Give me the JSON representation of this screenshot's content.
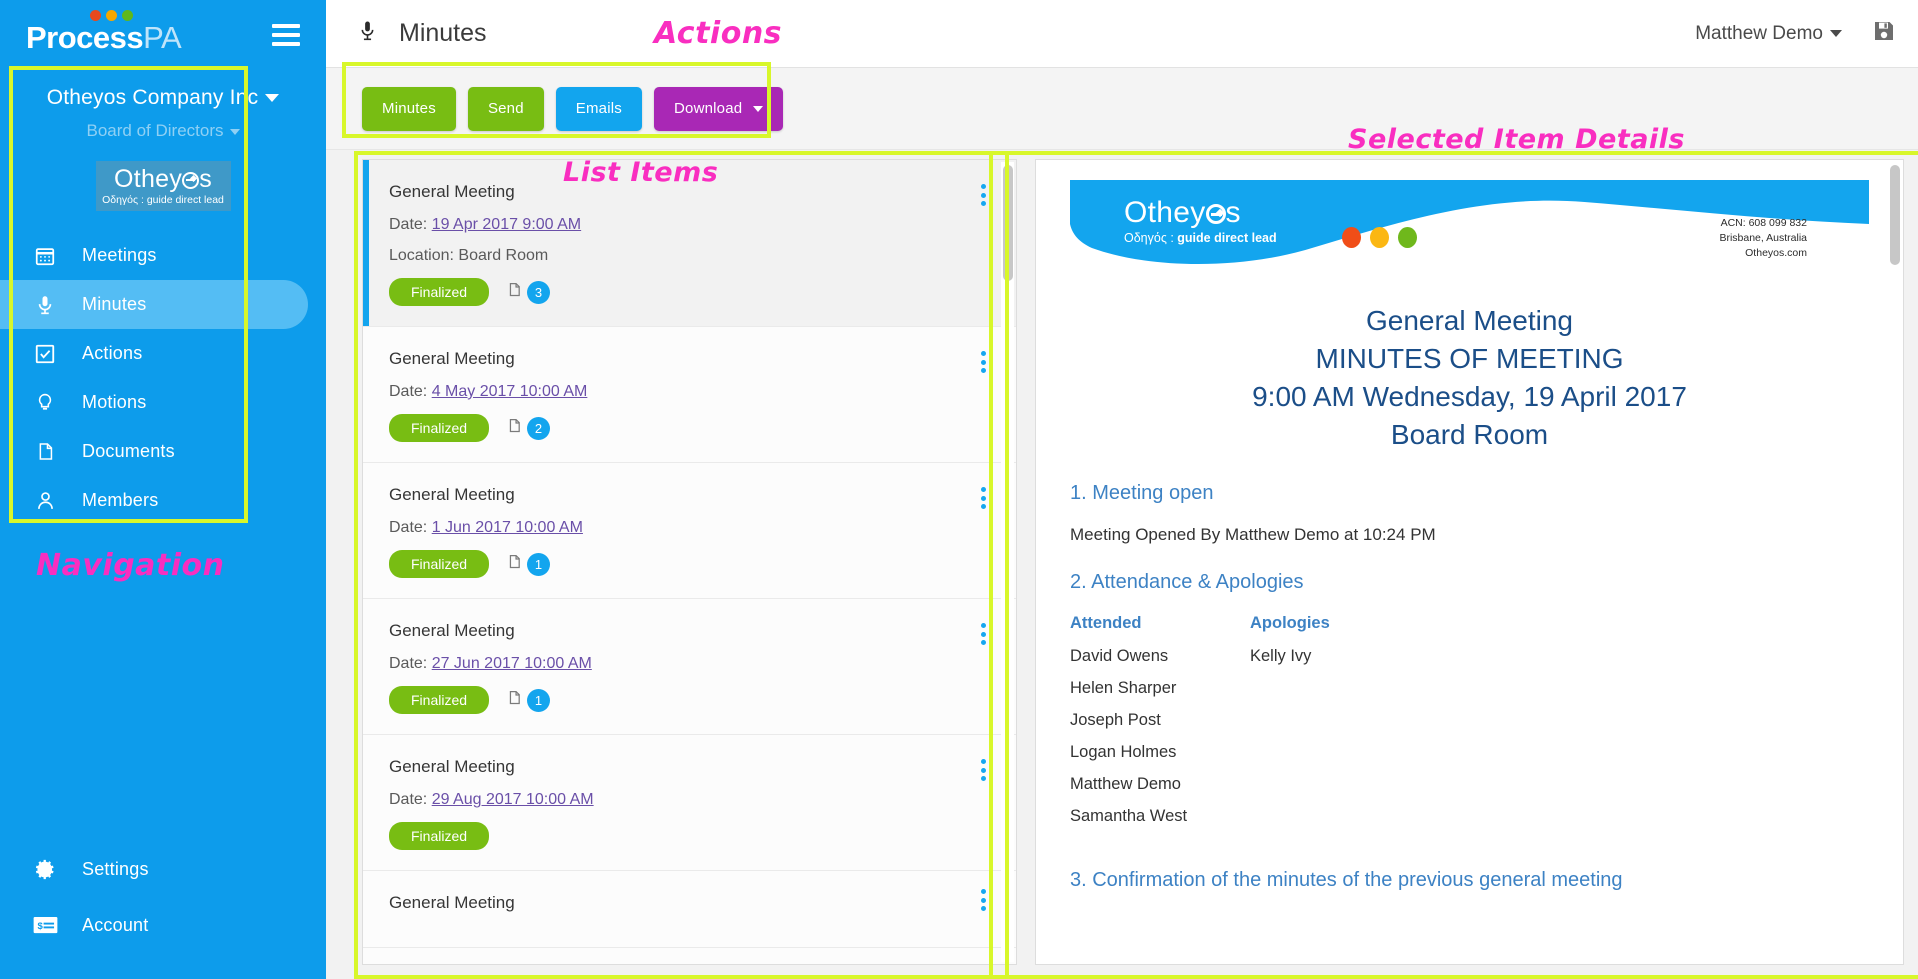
{
  "brand": {
    "name_bold": "Process",
    "name_light": "PA",
    "dot_colors": [
      "#e8491d",
      "#f5a700",
      "#5fb81a"
    ]
  },
  "sidebar": {
    "org_name": "Otheyos Company Inc",
    "org_sub": "Board of Directors",
    "team_logo": {
      "pre": "Othey",
      "post": "s",
      "tagline_greek": "Οδηγός : ",
      "tagline": "guide direct lead"
    },
    "items": [
      {
        "label": "Meetings",
        "icon": "calendar-icon",
        "active": false
      },
      {
        "label": "Minutes",
        "icon": "microphone-icon",
        "active": true
      },
      {
        "label": "Actions",
        "icon": "checkbox-icon",
        "active": false
      },
      {
        "label": "Motions",
        "icon": "lightbulb-icon",
        "active": false
      },
      {
        "label": "Documents",
        "icon": "document-icon",
        "active": false
      },
      {
        "label": "Members",
        "icon": "person-icon",
        "active": false
      }
    ],
    "bottom_items": [
      {
        "label": "Settings",
        "icon": "gear-icon"
      },
      {
        "label": "Account",
        "icon": "billing-card-icon"
      }
    ]
  },
  "topbar": {
    "title": "Minutes",
    "title_icon": "microphone-icon",
    "user_name": "Matthew Demo",
    "save_icon": "save-floppy-icon"
  },
  "actions": {
    "buttons": [
      {
        "label": "Minutes",
        "color": "#78bd13",
        "caret": false
      },
      {
        "label": "Send",
        "color": "#78bd13",
        "caret": false
      },
      {
        "label": "Emails",
        "color": "#12a5ee",
        "caret": false
      },
      {
        "label": "Download",
        "color": "#a928b5",
        "caret": true
      }
    ]
  },
  "list": {
    "date_prefix": "Date: ",
    "location_prefix": "Location: ",
    "items": [
      {
        "title": "General Meeting",
        "date": "19 Apr 2017 9:00 AM",
        "location": "Board Room",
        "status": "Finalized",
        "docs": "3",
        "selected": true
      },
      {
        "title": "General Meeting",
        "date": "4 May 2017 10:00 AM",
        "location": "",
        "status": "Finalized",
        "docs": "2",
        "selected": false
      },
      {
        "title": "General Meeting",
        "date": "1 Jun 2017 10:00 AM",
        "location": "",
        "status": "Finalized",
        "docs": "1",
        "selected": false
      },
      {
        "title": "General Meeting",
        "date": "27 Jun 2017 10:00 AM",
        "location": "",
        "status": "Finalized",
        "docs": "1",
        "selected": false
      },
      {
        "title": "General Meeting",
        "date": "29 Aug 2017 10:00 AM",
        "location": "",
        "status": "Finalized",
        "docs": "",
        "selected": false
      },
      {
        "title": "General Meeting",
        "date": "",
        "location": "",
        "status": "",
        "docs": "",
        "selected": false
      }
    ]
  },
  "detail": {
    "letterhead": {
      "logo_pre": "Othey",
      "logo_post": "s",
      "tagline_greek": "Οδηγός : ",
      "tagline": "guide direct lead",
      "dot_colors": [
        "#f04e18",
        "#fbb713",
        "#6fb81c"
      ],
      "acn": "ACN: 608 099 832",
      "city": "Brisbane, Australia",
      "web": "Otheyos.com"
    },
    "title_lines": [
      "General Meeting",
      "MINUTES OF MEETING",
      "9:00 AM Wednesday, 19 April 2017",
      "Board Room"
    ],
    "sections": [
      {
        "heading": "1. Meeting open",
        "body": "Meeting Opened By Matthew Demo at 10:24 PM"
      },
      {
        "heading": "2. Attendance & Apologies"
      },
      {
        "heading": "3. Confirmation of the minutes of the previous general meeting"
      }
    ],
    "attendance": {
      "col1_head": "Attended",
      "col2_head": "Apologies",
      "attended": [
        "David Owens",
        "Helen Sharper",
        "Joseph Post",
        "Logan Holmes",
        "Matthew Demo",
        "Samantha West"
      ],
      "apologies": [
        "Kelly Ivy"
      ]
    }
  },
  "annotations": {
    "navigation": "Navigation",
    "actions": "Actions",
    "list_items": "List Items",
    "selected_item_details": "Selected Item Details",
    "highlight_color": "#d8f72a",
    "text_color": "#f92ec0"
  }
}
